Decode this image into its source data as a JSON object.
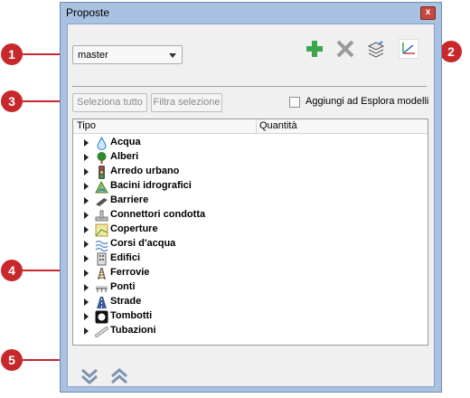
{
  "window": {
    "title": "Proposte",
    "close_label": "x"
  },
  "toolbar": {
    "branch_value": "master",
    "icons": [
      "add-icon",
      "delete-icon",
      "layers-icon",
      "axes-icon"
    ]
  },
  "filters": {
    "select_all_label": "Seleziona tutto",
    "filter_selection_label": "Filtra selezione",
    "add_to_explorer_label": "Aggiungi ad Esplora modelli",
    "add_to_explorer_checked": false
  },
  "tree": {
    "columns": [
      "Tipo",
      "Quantità"
    ],
    "rows": [
      {
        "label": "Acqua",
        "icon": "water-drop-icon"
      },
      {
        "label": "Alberi",
        "icon": "tree-icon"
      },
      {
        "label": "Arredo urbano",
        "icon": "traffic-light-icon"
      },
      {
        "label": "Bacini idrografici",
        "icon": "basin-icon"
      },
      {
        "label": "Barriere",
        "icon": "barrier-icon"
      },
      {
        "label": "Connettori condotta",
        "icon": "pipe-connector-icon"
      },
      {
        "label": "Coperture",
        "icon": "coverage-icon"
      },
      {
        "label": "Corsi d'acqua",
        "icon": "waterway-icon"
      },
      {
        "label": "Edifici",
        "icon": "building-icon"
      },
      {
        "label": "Ferrovie",
        "icon": "railway-icon"
      },
      {
        "label": "Ponti",
        "icon": "bridge-icon"
      },
      {
        "label": "Strade",
        "icon": "road-icon"
      },
      {
        "label": "Tombotti",
        "icon": "culvert-icon"
      },
      {
        "label": "Tubazioni",
        "icon": "pipe-icon"
      }
    ]
  },
  "bottom": {
    "icons": [
      "expand-all-icon",
      "collapse-all-icon"
    ]
  },
  "callouts": [
    "1",
    "2",
    "3",
    "4",
    "5"
  ],
  "colors": {
    "callout": "#c8282b",
    "add_green": "#3aa84a",
    "frame_blue": "#a9c2e1"
  }
}
